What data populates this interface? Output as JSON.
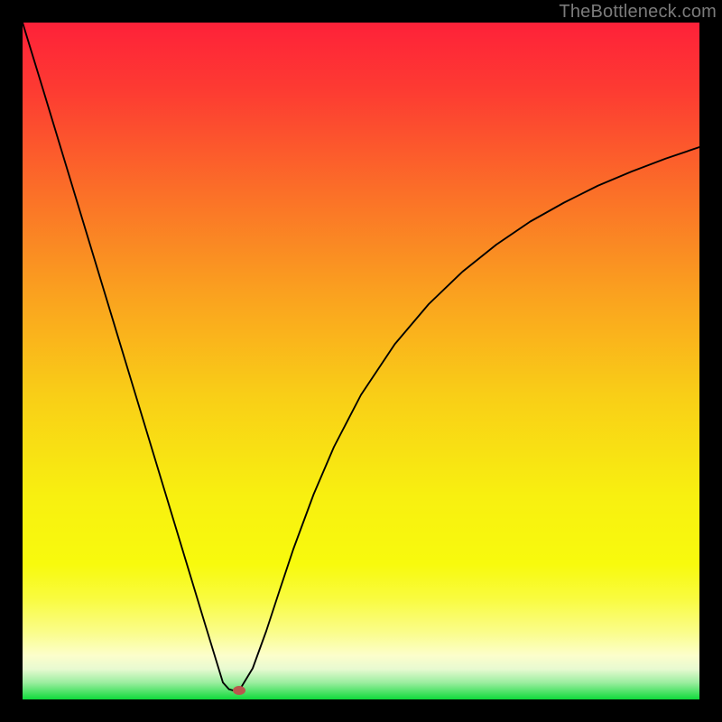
{
  "watermark": "TheBottleneck.com",
  "colors": {
    "frame": "#000000",
    "curve": "#000000",
    "marker": "#b9584d",
    "gradient_stops": [
      {
        "offset": 0.0,
        "hex": "#fe2139"
      },
      {
        "offset": 0.1,
        "hex": "#fd3b32"
      },
      {
        "offset": 0.25,
        "hex": "#fb6f28"
      },
      {
        "offset": 0.4,
        "hex": "#faa11f"
      },
      {
        "offset": 0.55,
        "hex": "#f9ce17"
      },
      {
        "offset": 0.7,
        "hex": "#f8f010"
      },
      {
        "offset": 0.8,
        "hex": "#f8fa0d"
      },
      {
        "offset": 0.85,
        "hex": "#f9fb3e"
      },
      {
        "offset": 0.9,
        "hex": "#fafd89"
      },
      {
        "offset": 0.935,
        "hex": "#fcfecb"
      },
      {
        "offset": 0.955,
        "hex": "#e8fad1"
      },
      {
        "offset": 0.975,
        "hex": "#9ceea0"
      },
      {
        "offset": 1.0,
        "hex": "#0fda3b"
      }
    ]
  },
  "chart_data": {
    "type": "line",
    "title": "",
    "xlabel": "",
    "ylabel": "",
    "xlim": [
      0,
      1
    ],
    "ylim": [
      0,
      1
    ],
    "grid": false,
    "legend": false,
    "series": [
      {
        "name": "bottleneck-curve",
        "x": [
          0.0,
          0.03,
          0.06,
          0.09,
          0.12,
          0.15,
          0.18,
          0.21,
          0.24,
          0.27,
          0.296,
          0.305,
          0.312,
          0.32,
          0.34,
          0.36,
          0.38,
          0.4,
          0.43,
          0.46,
          0.5,
          0.55,
          0.6,
          0.65,
          0.7,
          0.75,
          0.8,
          0.85,
          0.9,
          0.95,
          1.0
        ],
        "y": [
          1.0,
          0.902,
          0.803,
          0.704,
          0.605,
          0.506,
          0.407,
          0.308,
          0.209,
          0.11,
          0.025,
          0.015,
          0.013,
          0.013,
          0.046,
          0.101,
          0.162,
          0.222,
          0.303,
          0.373,
          0.45,
          0.525,
          0.584,
          0.632,
          0.672,
          0.706,
          0.734,
          0.759,
          0.78,
          0.799,
          0.816
        ]
      }
    ],
    "marker": {
      "x": 0.32,
      "y": 0.013
    }
  }
}
